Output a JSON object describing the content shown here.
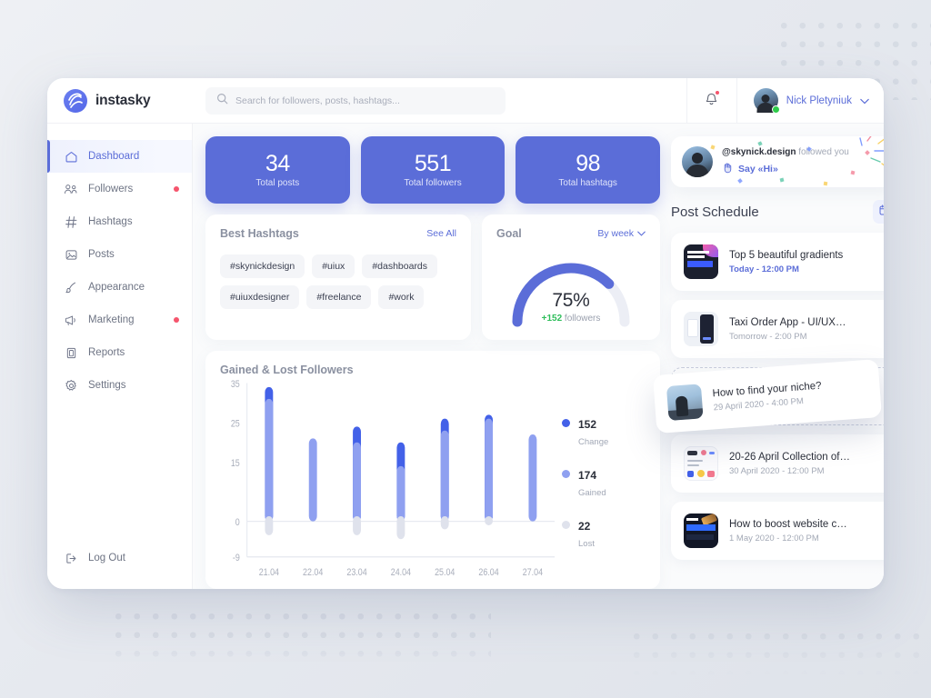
{
  "brand": {
    "name": "instasky",
    "accent": "#5b6dd8"
  },
  "search": {
    "placeholder": "Search for followers, posts, hashtags...",
    "value": ""
  },
  "topbar": {
    "notifications_icon": "bell-icon",
    "profile_name": "Nick Pletyniuk",
    "chevron": "⌄"
  },
  "sidebar": {
    "items": [
      {
        "label": "Dashboard",
        "icon": "home-icon",
        "active": true,
        "dot": false
      },
      {
        "label": "Followers",
        "icon": "users-icon",
        "active": false,
        "dot": true
      },
      {
        "label": "Hashtags",
        "icon": "hash-icon",
        "active": false,
        "dot": false
      },
      {
        "label": "Posts",
        "icon": "image-icon",
        "active": false,
        "dot": false
      },
      {
        "label": "Appearance",
        "icon": "brush-icon",
        "active": false,
        "dot": false
      },
      {
        "label": "Marketing",
        "icon": "megaphone-icon",
        "active": false,
        "dot": true
      },
      {
        "label": "Reports",
        "icon": "clipboard-icon",
        "active": false,
        "dot": false
      },
      {
        "label": "Settings",
        "icon": "gear-icon",
        "active": false,
        "dot": false
      }
    ],
    "logout": {
      "label": "Log Out",
      "icon": "logout-icon"
    }
  },
  "stats": [
    {
      "value": "34",
      "caption": "Total posts"
    },
    {
      "value": "551",
      "caption": "Total followers"
    },
    {
      "value": "98",
      "caption": "Total hashtags"
    }
  ],
  "hashtags_card": {
    "title": "Best Hashtags",
    "see_all": "See All",
    "tags": [
      "#skynickdesign",
      "#uiux",
      "#dashboards",
      "#uiuxdesigner",
      "#freelance",
      "#work"
    ]
  },
  "goal_card": {
    "title": "Goal",
    "period": "By week",
    "percent_label": "75%",
    "percent_value": 75,
    "delta": "+152",
    "delta_caption": "followers"
  },
  "chart_data": {
    "type": "bar",
    "title": "Gained & Lost Followers",
    "categories": [
      "21.04",
      "22.04",
      "23.04",
      "24.04",
      "25.04",
      "26.04",
      "27.04"
    ],
    "series": [
      {
        "name": "Change",
        "color": "#4361e8",
        "values": [
          34,
          0,
          24,
          20,
          26,
          27,
          0
        ]
      },
      {
        "name": "Gained",
        "color": "#8fa0f0",
        "values": [
          31,
          21,
          20,
          14,
          23,
          26,
          22
        ]
      },
      {
        "name": "Lost",
        "color": "#dfe2ec",
        "values": [
          -3.5,
          0,
          -3.5,
          -4.5,
          -2,
          -1,
          0
        ]
      }
    ],
    "yticks": [
      35,
      25,
      15,
      0,
      -9
    ],
    "ylim": [
      -9,
      35
    ],
    "xlabel": "",
    "ylabel": "",
    "grid": false,
    "legend_position": "right",
    "legend": [
      {
        "value": "152",
        "label": "Change",
        "color": "#4361e8"
      },
      {
        "value": "174",
        "label": "Gained",
        "color": "#8fa0f0"
      },
      {
        "value": "22",
        "label": "Lost",
        "color": "#dfe2ec"
      }
    ]
  },
  "notification": {
    "user": "@skynick.design",
    "text": " followed you",
    "action": "Say «Hi»",
    "wave_icon": "waving-hand-icon"
  },
  "post_schedule": {
    "title": "Post Schedule",
    "calendar_icon": "calendar-icon",
    "items": [
      {
        "name": "Top 5 beautiful gradients",
        "time": "Today - 12:00 PM",
        "today": true,
        "thumb": "gradients-thumb"
      },
      {
        "name": "Taxi Order App - UI/UX…",
        "time": "Tomorrow - 2:00 PM",
        "today": false,
        "thumb": "taxi-thumb"
      },
      {
        "name": "How to find your niche?",
        "time": "29 April 2020 - 4:00 PM",
        "today": false,
        "thumb": "niche-thumb",
        "dragging": true
      },
      {
        "name": "20-26 April Collection of…",
        "time": "30 April 2020 - 12:00 PM",
        "today": false,
        "thumb": "collection-thumb"
      },
      {
        "name": "How to boost website c…",
        "time": "1 May 2020 - 12:00 PM",
        "today": false,
        "thumb": "boost-thumb"
      }
    ]
  }
}
